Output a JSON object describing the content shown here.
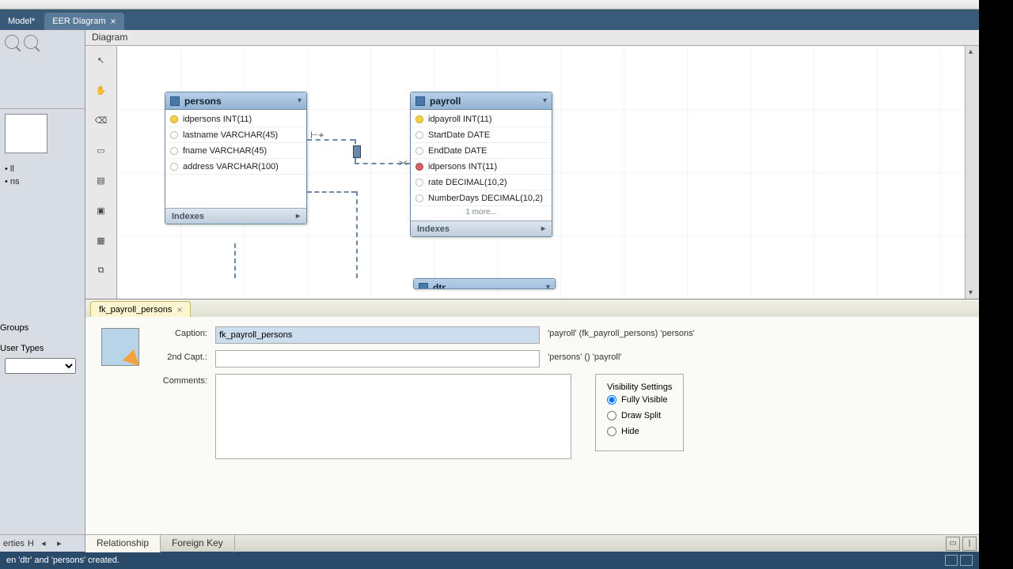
{
  "tabs": {
    "model": "Model*",
    "eer": "EER Diagram"
  },
  "diagram_title": "Diagram",
  "sidebar": {
    "tree_items": [
      "ll",
      "ns"
    ],
    "group_layers": "Groups",
    "group_user": "User Types"
  },
  "entities": {
    "persons": {
      "name": "persons",
      "cols": [
        {
          "n": "idpersons INT(11)",
          "k": "pk"
        },
        {
          "n": "lastname VARCHAR(45)",
          "k": ""
        },
        {
          "n": "fname VARCHAR(45)",
          "k": ""
        },
        {
          "n": "address VARCHAR(100)",
          "k": ""
        }
      ],
      "footer": "Indexes"
    },
    "payroll": {
      "name": "payroll",
      "cols": [
        {
          "n": "idpayroll INT(11)",
          "k": "pk"
        },
        {
          "n": "StartDate DATE",
          "k": ""
        },
        {
          "n": "EndDate DATE",
          "k": ""
        },
        {
          "n": "idpersons INT(11)",
          "k": "fk"
        },
        {
          "n": "rate DECIMAL(10,2)",
          "k": ""
        },
        {
          "n": "NumberDays DECIMAL(10,2)",
          "k": ""
        }
      ],
      "more": "1 more...",
      "footer": "Indexes"
    },
    "dtr": {
      "name": "dtr"
    }
  },
  "prop": {
    "tab": "fk_payroll_persons",
    "caption_label": "Caption:",
    "caption_value": "fk_payroll_persons",
    "caption_readout": "'payroll' (fk_payroll_persons) 'persons'",
    "second_label": "2nd Capt.:",
    "second_value": "",
    "second_readout": "'persons' () 'payroll'",
    "comments_label": "Comments:",
    "comments_value": "",
    "visibility": {
      "legend": "Visibility Settings",
      "opts": [
        "Fully Visible",
        "Draw Split",
        "Hide"
      ],
      "selected": 0
    }
  },
  "bottom_tabs": {
    "rel": "Relationship",
    "fk": "Foreign Key"
  },
  "left_bottom": {
    "label": "erties"
  },
  "status": "en 'dtr' and 'persons' created."
}
